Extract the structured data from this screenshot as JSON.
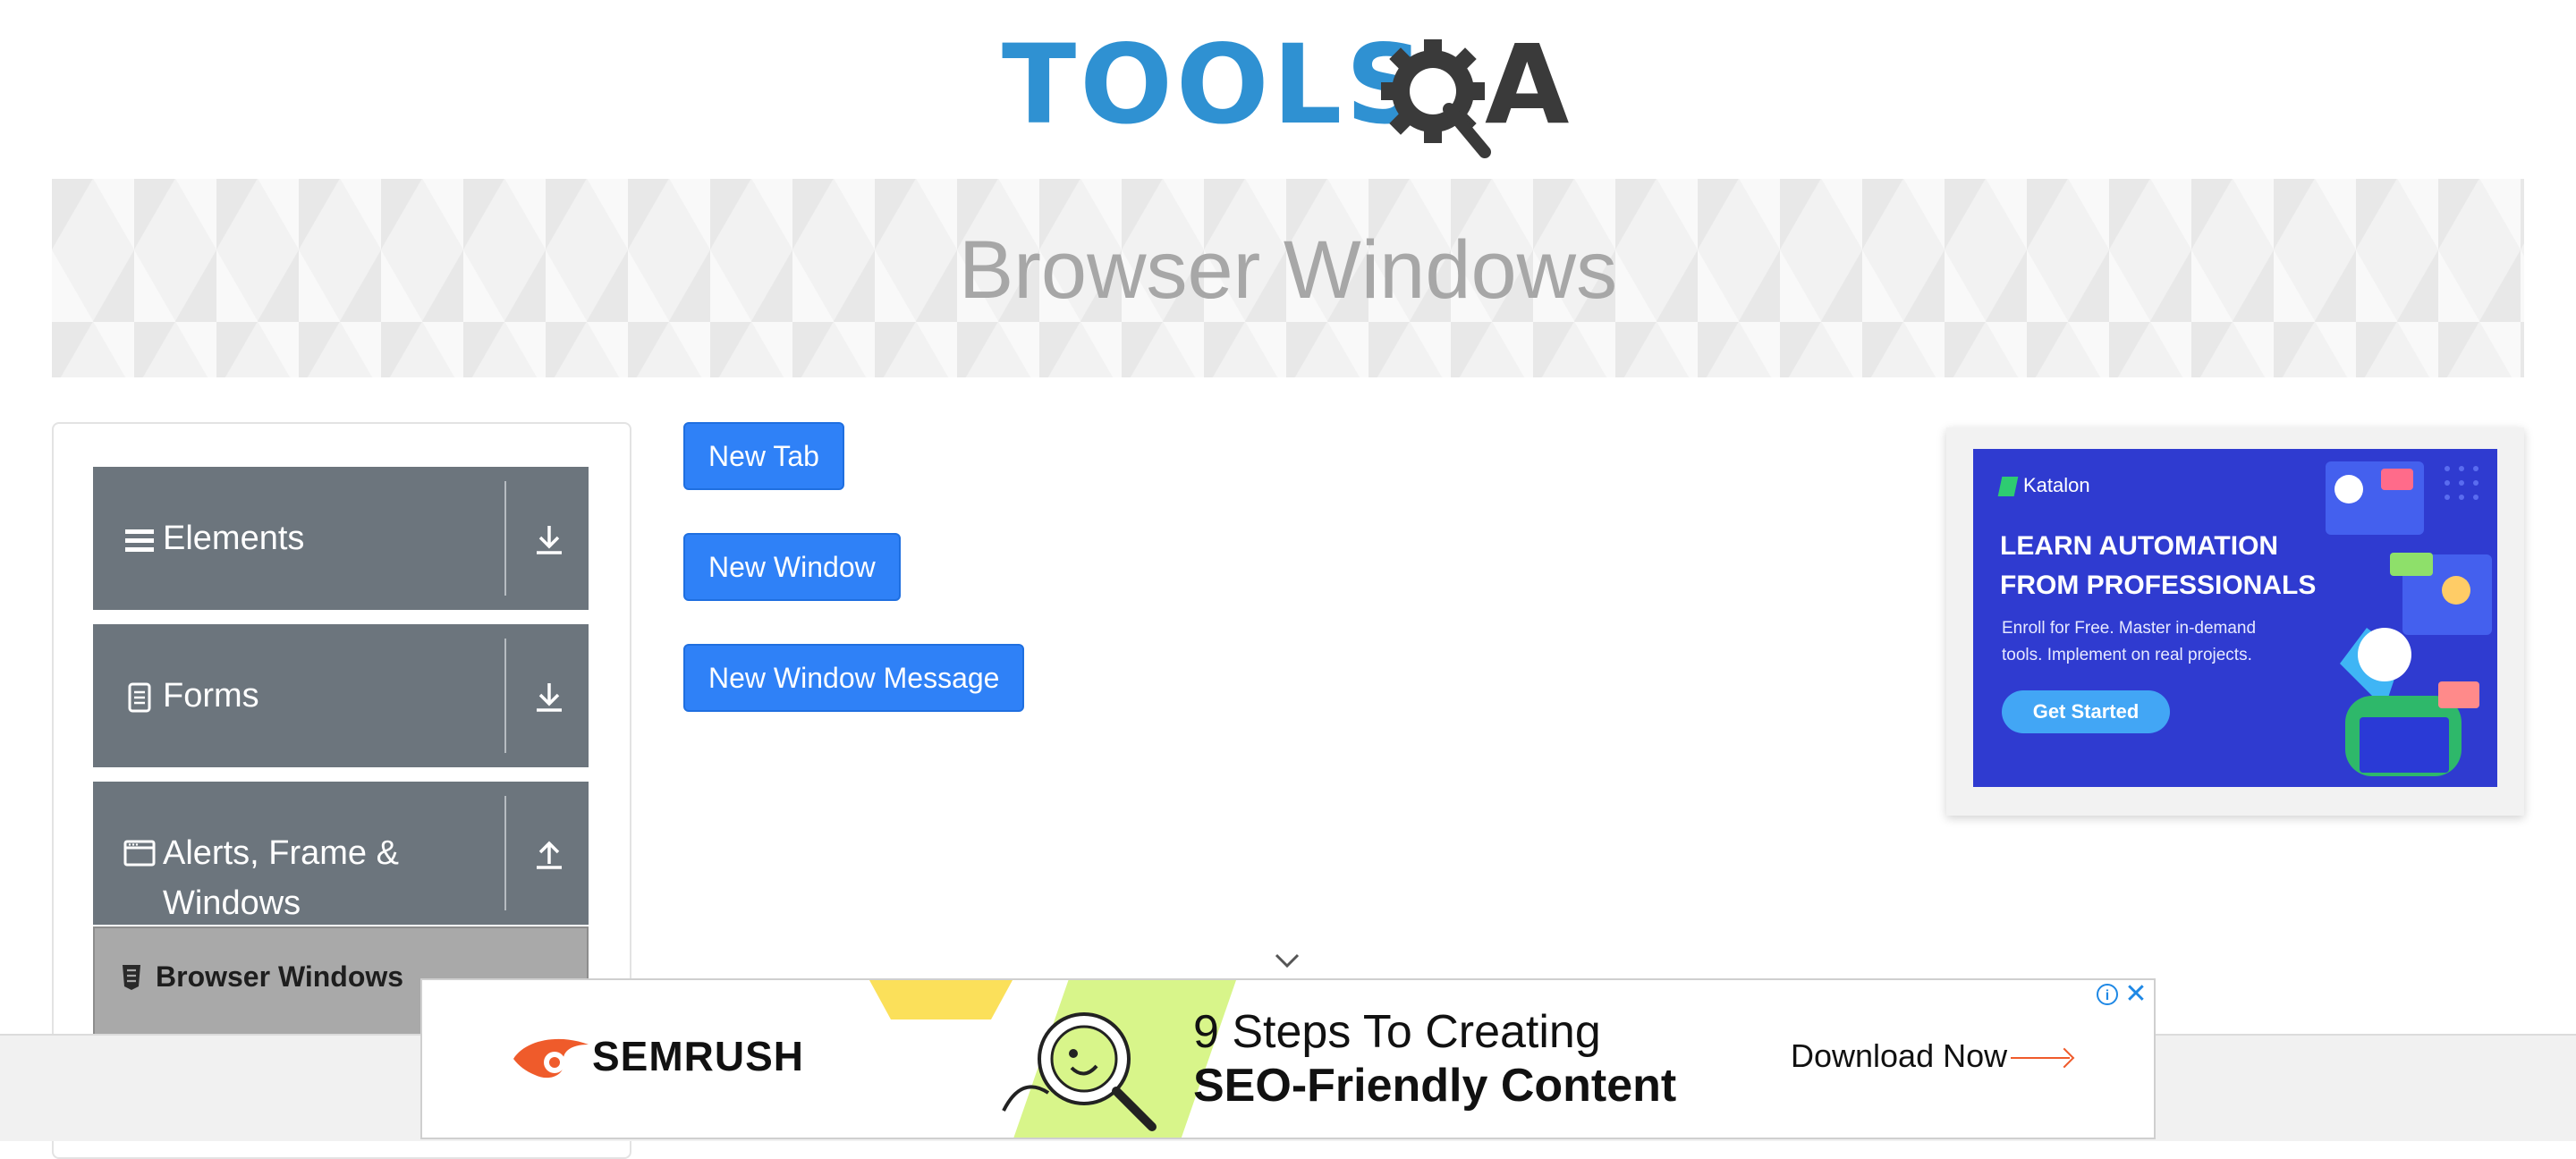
{
  "logo": {
    "text": "TOOLS",
    "letter": "A"
  },
  "page": {
    "title": "Browser Windows"
  },
  "sidebar": {
    "groups": [
      {
        "label": "Elements",
        "icon": "hamburger-icon",
        "arrow": "download-arrow-icon"
      },
      {
        "label": "Forms",
        "icon": "document-icon",
        "arrow": "download-arrow-icon"
      },
      {
        "label_line1": "Alerts, Frame &",
        "label_line2": "Windows",
        "icon": "window-icon",
        "arrow": "upload-arrow-icon"
      }
    ],
    "active_item": {
      "label": "Browser Windows",
      "icon": "html5-icon"
    }
  },
  "buttons": {
    "new_tab": "New Tab",
    "new_window": "New Window",
    "new_window_message": "New Window Message"
  },
  "side_ad": {
    "brand": "Katalon",
    "headline_line1": "LEARN AUTOMATION",
    "headline_line2": "FROM PROFESSIONALS",
    "sub_line1": "Enroll for Free. Master in-demand",
    "sub_line2": "tools. Implement on real projects.",
    "cta": "Get Started",
    "bg_color": "#2f3bd0"
  },
  "bottom_ad": {
    "brand": "SEMRUSH",
    "line1": "9 Steps To Creating",
    "line2": "SEO-Friendly Content",
    "cta": "Download Now",
    "accent_color": "#ef5b2b"
  },
  "colors": {
    "primary_button": "#2f81f7",
    "sidebar_group": "#6c757d",
    "sidebar_active": "#a9a9a9",
    "logo_blue": "#2f91d2"
  }
}
